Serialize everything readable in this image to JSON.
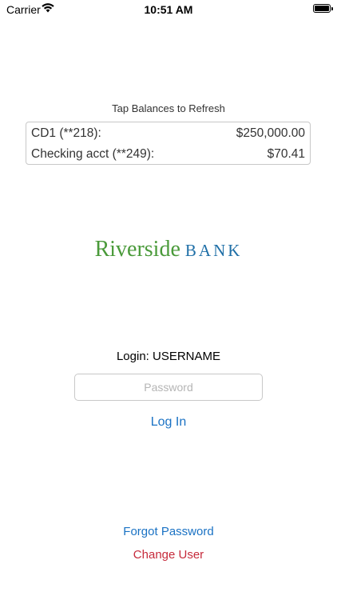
{
  "status_bar": {
    "carrier": "Carrier",
    "time": "10:51 AM"
  },
  "balances": {
    "hint": "Tap Balances to Refresh",
    "accounts": [
      {
        "name": "CD1 (**218):",
        "amount": "$250,000.00"
      },
      {
        "name": "Checking acct (**249):",
        "amount": "$70.41"
      }
    ]
  },
  "logo": {
    "primary": "Riverside",
    "secondary": "BANK"
  },
  "login": {
    "label": "Login: USERNAME",
    "password_placeholder": "Password",
    "login_button": "Log In"
  },
  "footer": {
    "forgot_password": "Forgot Password",
    "change_user": "Change User"
  },
  "colors": {
    "link": "#1a72c4",
    "destructive": "#c62a3b",
    "logo_green": "#4a9a3a",
    "logo_blue": "#1f6fa7"
  }
}
